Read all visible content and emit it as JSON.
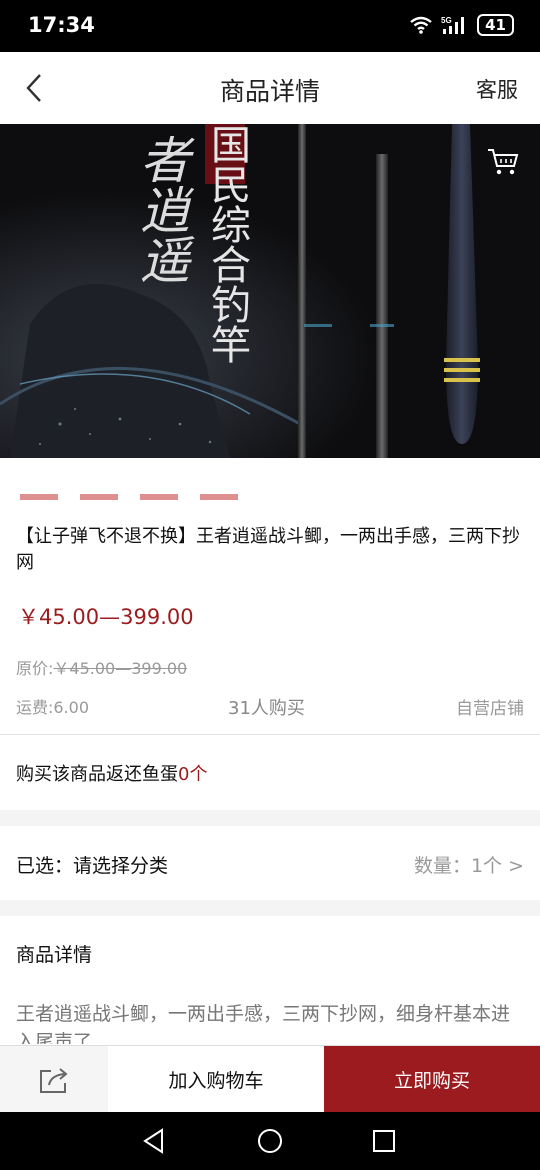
{
  "status": {
    "time": "17:34",
    "battery": "41",
    "network": "5G",
    "icons": [
      "wifi-icon",
      "signal-icon",
      "battery-icon"
    ]
  },
  "nav": {
    "title": "商品详情",
    "service": "客服"
  },
  "product": {
    "title": "【让子弹飞不退不换】王者逍遥战斗鲫，一两出手感，三两下抄网",
    "price": "￥45.00—399.00",
    "orig_label": "原价:",
    "orig_price": "￥45.00—399.00",
    "shipping": "运费:6.00",
    "buyers": "31人购买",
    "store": "自营店铺",
    "rebate_text": "购买该商品返还鱼蛋",
    "rebate_count": "0个"
  },
  "hero_image": {
    "text_right": "国民综合钓竿",
    "text_left": "者逍遥"
  },
  "selection": {
    "label": "已选：请选择分类",
    "quantity": "数量：1个 >"
  },
  "detail": {
    "heading": "商品详情",
    "desc": "王者逍遥战斗鲫，一两出手感，三两下抄网，细身杆基本进入尾声了"
  },
  "bottom": {
    "add_cart": "加入购物车",
    "buy_now": "立即购买"
  },
  "colors": {
    "accent": "#9b1b1e",
    "price": "#9b1c1f"
  }
}
